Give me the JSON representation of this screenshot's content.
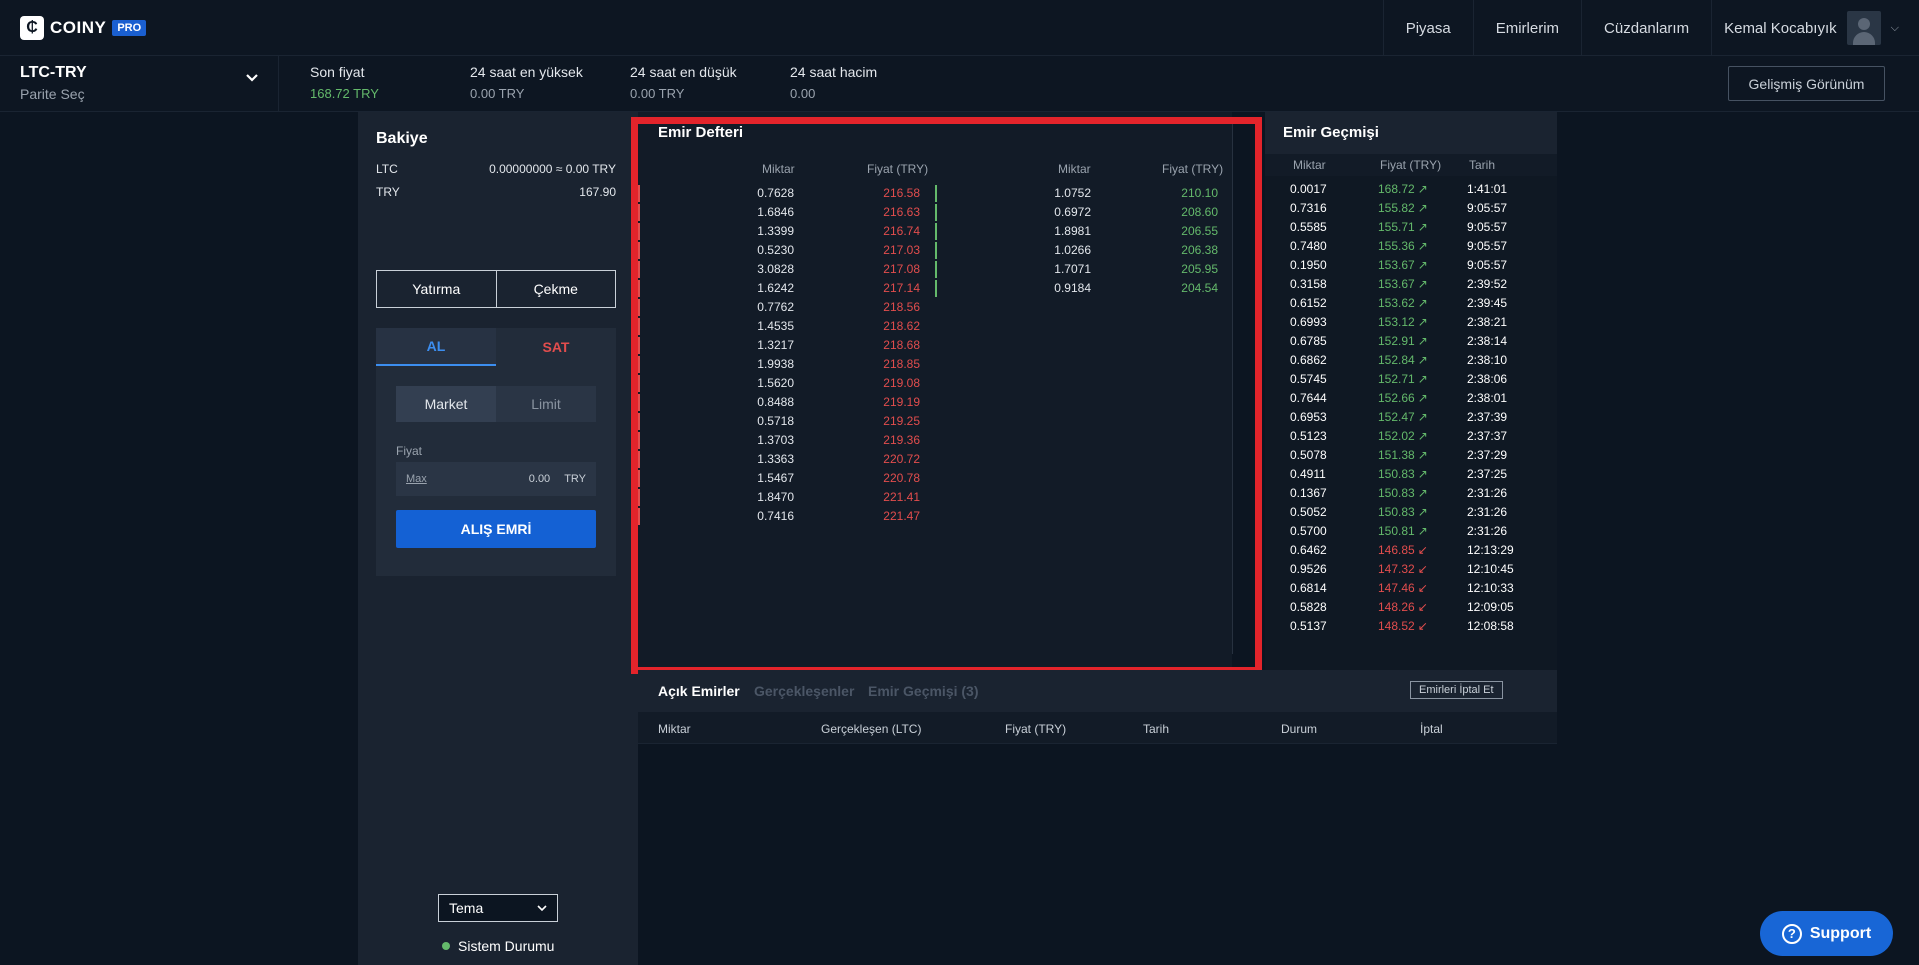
{
  "brand": {
    "name": "COINY",
    "badge": "PRO",
    "logo_glyph": "₵"
  },
  "nav": {
    "items": [
      "Piyasa",
      "Emirlerim",
      "Cüzdanlarım"
    ],
    "user": "Kemal Kocabıyık"
  },
  "ticker": {
    "pair": "LTC-TRY",
    "pair_sub": "Parite Seç",
    "stats": [
      {
        "label": "Son fiyat",
        "value": "168.72 TRY"
      },
      {
        "label": "24 saat en yüksek",
        "value": "0.00 TRY"
      },
      {
        "label": "24 saat en düşük",
        "value": "0.00 TRY"
      },
      {
        "label": "24 saat hacim",
        "value": "0.00"
      }
    ],
    "advanced_button": "Gelişmiş Görünüm"
  },
  "balance": {
    "title": "Bakiye",
    "rows": [
      {
        "asset": "LTC",
        "value": "0.00000000 ≈ 0.00 TRY"
      },
      {
        "asset": "TRY",
        "value": "167.90"
      }
    ],
    "deposit": "Yatırma",
    "withdraw": "Çekme"
  },
  "trade": {
    "buy_tab": "AL",
    "sell_tab": "SAT",
    "market": "Market",
    "limit": "Limit",
    "price_label": "Fiyat",
    "max": "Max",
    "price_value": "0.00",
    "currency": "TRY",
    "submit": "ALIŞ EMRİ"
  },
  "footer_left": {
    "theme": "Tema",
    "system_status": "Sistem Durumu"
  },
  "orderbook": {
    "title": "Emir Defteri",
    "col_amount": "Miktar",
    "col_price": "Fiyat (TRY)",
    "asks": [
      [
        "0.7628",
        "216.58"
      ],
      [
        "1.6846",
        "216.63"
      ],
      [
        "1.3399",
        "216.74"
      ],
      [
        "0.5230",
        "217.03"
      ],
      [
        "3.0828",
        "217.08"
      ],
      [
        "1.6242",
        "217.14"
      ],
      [
        "0.7762",
        "218.56"
      ],
      [
        "1.4535",
        "218.62"
      ],
      [
        "1.3217",
        "218.68"
      ],
      [
        "1.9938",
        "218.85"
      ],
      [
        "1.5620",
        "219.08"
      ],
      [
        "0.8488",
        "219.19"
      ],
      [
        "0.5718",
        "219.25"
      ],
      [
        "1.3703",
        "219.36"
      ],
      [
        "1.3363",
        "220.72"
      ],
      [
        "1.5467",
        "220.78"
      ],
      [
        "1.8470",
        "221.41"
      ],
      [
        "0.7416",
        "221.47"
      ]
    ],
    "bids": [
      [
        "1.0752",
        "210.10"
      ],
      [
        "0.6972",
        "208.60"
      ],
      [
        "1.8981",
        "206.55"
      ],
      [
        "1.0266",
        "206.38"
      ],
      [
        "1.7071",
        "205.95"
      ],
      [
        "0.9184",
        "204.54"
      ]
    ]
  },
  "history": {
    "title": "Emir Geçmişi",
    "col_amount": "Miktar",
    "col_price": "Fiyat (TRY)",
    "col_date": "Tarih",
    "rows": [
      {
        "amount": "0.0017",
        "price": "168.72",
        "dir": "up",
        "time": "1:41:01"
      },
      {
        "amount": "0.7316",
        "price": "155.82",
        "dir": "up",
        "time": "9:05:57"
      },
      {
        "amount": "0.5585",
        "price": "155.71",
        "dir": "up",
        "time": "9:05:57"
      },
      {
        "amount": "0.7480",
        "price": "155.36",
        "dir": "up",
        "time": "9:05:57"
      },
      {
        "amount": "0.1950",
        "price": "153.67",
        "dir": "up",
        "time": "9:05:57"
      },
      {
        "amount": "0.3158",
        "price": "153.67",
        "dir": "up",
        "time": "2:39:52"
      },
      {
        "amount": "0.6152",
        "price": "153.62",
        "dir": "up",
        "time": "2:39:45"
      },
      {
        "amount": "0.6993",
        "price": "153.12",
        "dir": "up",
        "time": "2:38:21"
      },
      {
        "amount": "0.6785",
        "price": "152.91",
        "dir": "up",
        "time": "2:38:14"
      },
      {
        "amount": "0.6862",
        "price": "152.84",
        "dir": "up",
        "time": "2:38:10"
      },
      {
        "amount": "0.5745",
        "price": "152.71",
        "dir": "up",
        "time": "2:38:06"
      },
      {
        "amount": "0.7644",
        "price": "152.66",
        "dir": "up",
        "time": "2:38:01"
      },
      {
        "amount": "0.6953",
        "price": "152.47",
        "dir": "up",
        "time": "2:37:39"
      },
      {
        "amount": "0.5123",
        "price": "152.02",
        "dir": "up",
        "time": "2:37:37"
      },
      {
        "amount": "0.5078",
        "price": "151.38",
        "dir": "up",
        "time": "2:37:29"
      },
      {
        "amount": "0.4911",
        "price": "150.83",
        "dir": "up",
        "time": "2:37:25"
      },
      {
        "amount": "0.1367",
        "price": "150.83",
        "dir": "up",
        "time": "2:31:26"
      },
      {
        "amount": "0.5052",
        "price": "150.83",
        "dir": "up",
        "time": "2:31:26"
      },
      {
        "amount": "0.5700",
        "price": "150.81",
        "dir": "up",
        "time": "2:31:26"
      },
      {
        "amount": "0.6462",
        "price": "146.85",
        "dir": "down",
        "time": "12:13:29"
      },
      {
        "amount": "0.9526",
        "price": "147.32",
        "dir": "down",
        "time": "12:10:45"
      },
      {
        "amount": "0.6814",
        "price": "147.46",
        "dir": "down",
        "time": "12:10:33"
      },
      {
        "amount": "0.5828",
        "price": "148.26",
        "dir": "down",
        "time": "12:09:05"
      },
      {
        "amount": "0.5137",
        "price": "148.52",
        "dir": "down",
        "time": "12:08:58"
      }
    ]
  },
  "open_orders": {
    "tabs": [
      "Açık Emirler",
      "Gerçekleşenler",
      "Emir Geçmişi (3)"
    ],
    "cancel_all": "Emirleri İptal Et",
    "columns": [
      "Miktar",
      "Gerçekleşen (LTC)",
      "Fiyat (TRY)",
      "Tarih",
      "Durum",
      "İptal"
    ]
  },
  "support": {
    "label": "Support",
    "icon_glyph": "?"
  },
  "colors": {
    "buy": "#64b96b",
    "sell": "#e24d4d",
    "accent": "#1461d4",
    "highlight": "#e3242b"
  }
}
